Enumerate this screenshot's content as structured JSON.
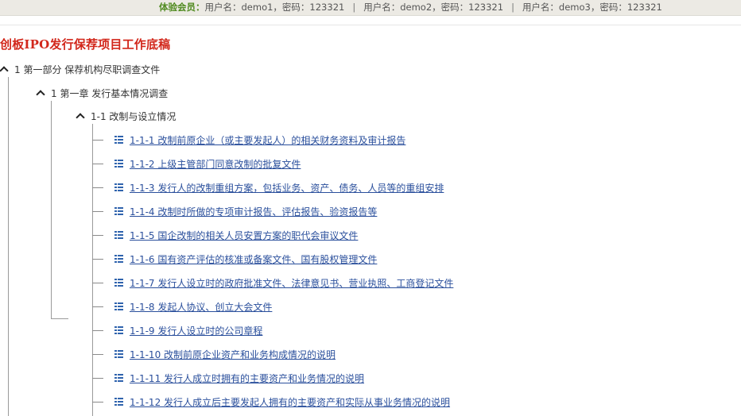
{
  "topbar": {
    "member_label": "体验会员：",
    "accounts": [
      "用户名：demo1，密码：123321",
      "用户名：demo2，密码：123321",
      "用户名：demo3，密码：123321"
    ],
    "separator": "|"
  },
  "page_title": "创板IPO发行保荐项目工作底稿",
  "tree": {
    "part": {
      "label": "1 第一部分 保荐机构尽职调查文件"
    },
    "chapter": {
      "label": "1 第一章 发行基本情况调查"
    },
    "section": {
      "label": "1-1 改制与设立情况"
    },
    "items": [
      {
        "label": "1-1-1 改制前原企业（或主要发起人）的相关财务资料及审计报告"
      },
      {
        "label": "1-1-2 上级主管部门同意改制的批复文件"
      },
      {
        "label": "1-1-3 发行人的改制重组方案，包括业务、资产、债务、人员等的重组安排"
      },
      {
        "label": "1-1-4 改制时所做的专项审计报告、评估报告、验资报告等"
      },
      {
        "label": "1-1-5 国企改制的相关人员安置方案的职代会审议文件"
      },
      {
        "label": "1-1-6 国有资产评估的核准或备案文件、国有股权管理文件"
      },
      {
        "label": "1-1-7 发行人设立时的政府批准文件、法律意见书、营业执照、工商登记文件"
      },
      {
        "label": "1-1-8 发起人协议、创立大会文件"
      },
      {
        "label": "1-1-9 发行人设立时的公司章程"
      },
      {
        "label": "1-1-10 改制前原企业资产和业务构成情况的说明"
      },
      {
        "label": "1-1-11 发行人成立时拥有的主要资产和业务情况的说明"
      },
      {
        "label": "1-1-12 发行人成立后主要发起人拥有的主要资产和实际从事业务情况的说明"
      }
    ]
  }
}
